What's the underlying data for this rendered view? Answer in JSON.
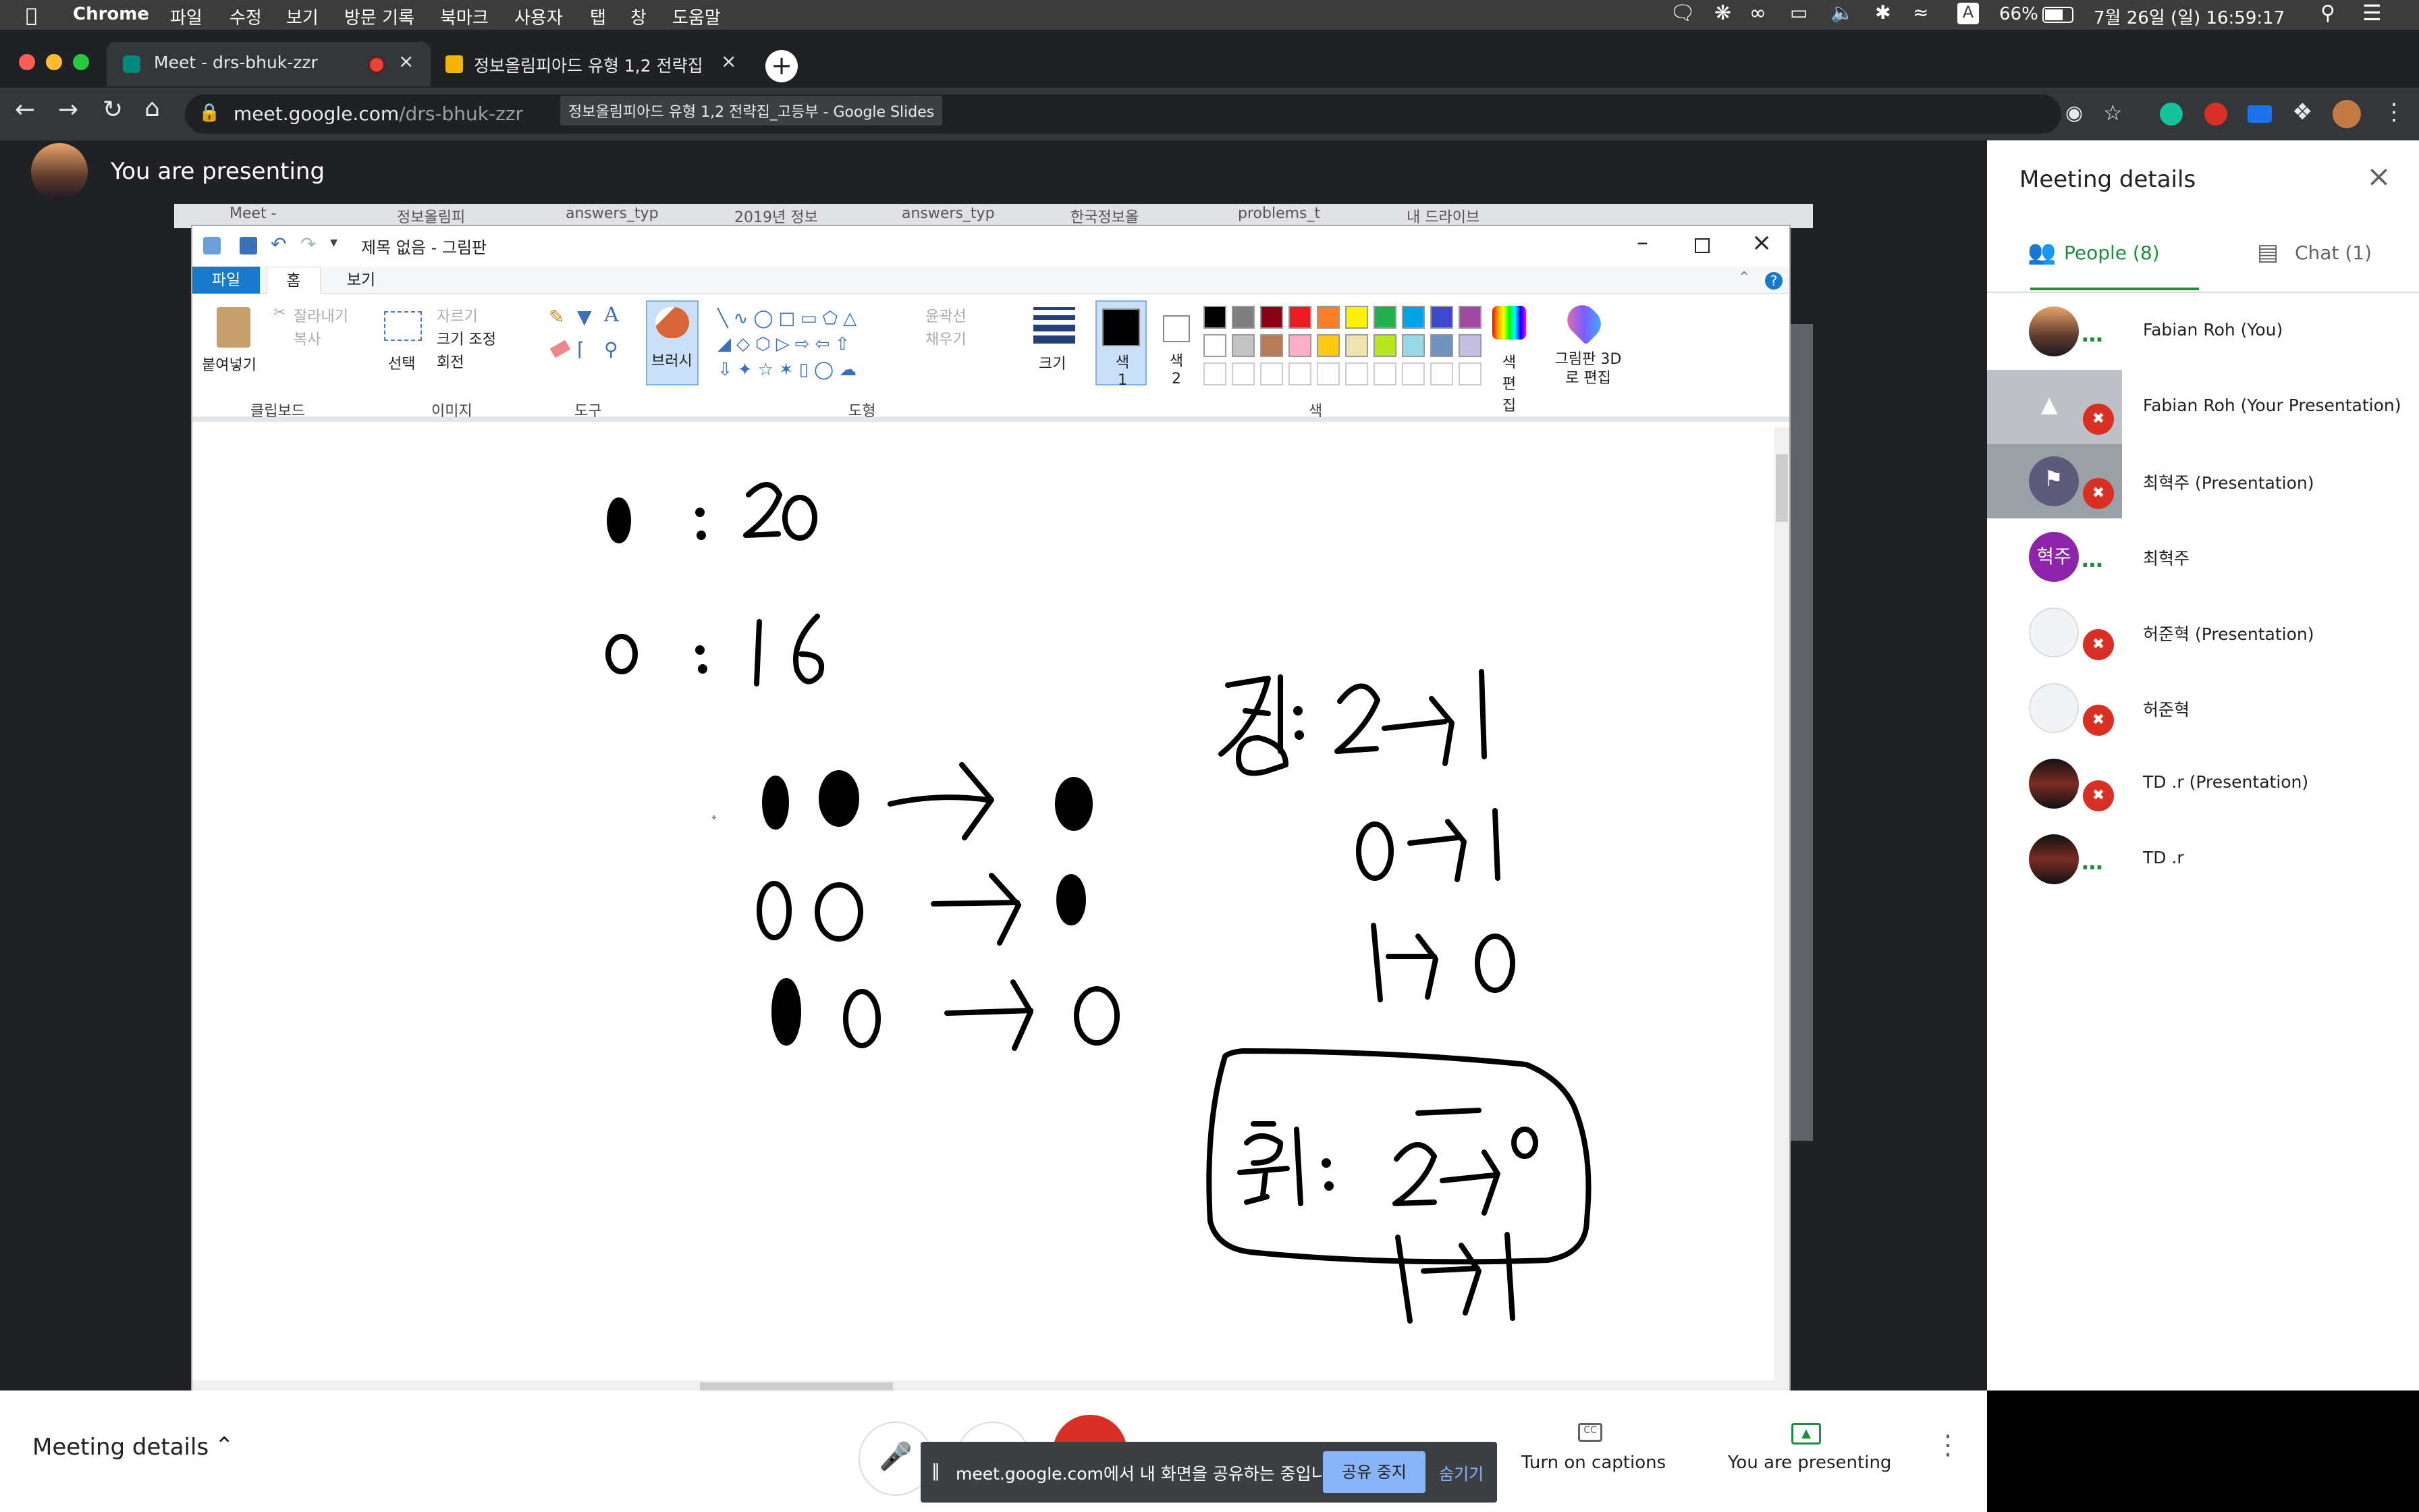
{
  "menubar": {
    "app": "Chrome",
    "items": [
      "파일",
      "수정",
      "보기",
      "방문 기록",
      "북마크",
      "사용자",
      "탭",
      "창",
      "도움말"
    ],
    "battery": "66%",
    "datetime": "7월 26일 (일) 16:59:17",
    "input_badge": "A"
  },
  "tabs": [
    {
      "title": "Meet - drs-bhuk-zzr",
      "active": true
    },
    {
      "title": "정보올림피아드 유형 1,2 전략집_고등",
      "active": false
    }
  ],
  "tooltip": "정보올림피아드 유형 1,2 전략집_고등부 - Google Slides",
  "omnibox": {
    "url_host": "meet.google.com",
    "url_path": "/drs-bhuk-zzr"
  },
  "presenting_banner": "You are presenting",
  "inner_tabs": [
    "Meet -",
    "정보올림피",
    "answers_typ",
    "2019년 정보",
    "answers_typ",
    "한국정보올",
    "problems_t",
    "내 드라이브"
  ],
  "paint": {
    "title": "제목 없음 - 그림판",
    "tabs": {
      "file": "파일",
      "home": "홈",
      "view": "보기"
    },
    "ribbon": {
      "paste": "붙여넣기",
      "cut": "잘라내기",
      "copy": "복사",
      "select": "선택",
      "crop": "자르기",
      "resize": "크기 조정",
      "rotate": "회전",
      "brush": "브러시",
      "outline": "윤곽선",
      "fill": "채우기",
      "size": "크기",
      "color1": "색 1",
      "color2": "색 2",
      "edit_colors": "색 편집",
      "paint3d": "그림판 3D로 편집",
      "group_clipboard": "클립보드",
      "group_image": "이미지",
      "group_tools": "도구",
      "group_shapes": "도형",
      "group_colors": "색"
    },
    "palette": [
      "#000000",
      "#7f7f7f",
      "#880015",
      "#ed1c24",
      "#ff7f27",
      "#fff200",
      "#22b14c",
      "#00a2e8",
      "#3f48cc",
      "#a349a4",
      "#ffffff",
      "#c3c3c3",
      "#b97a57",
      "#ffaec9",
      "#ffc90e",
      "#efe4b0",
      "#b5e61d",
      "#99d9ea",
      "#7092be",
      "#c8bfe7"
    ]
  },
  "panel": {
    "title": "Meeting details",
    "tab_people": "People (8)",
    "tab_chat": "Chat (1)",
    "people": [
      {
        "name": "Fabian Roh (You)",
        "muted": false,
        "avatar": "photo"
      },
      {
        "name": "Fabian Roh (Your Presentation)",
        "muted": true,
        "avatar": "present"
      },
      {
        "name": "최혁주 (Presentation)",
        "muted": true,
        "avatar": "pin"
      },
      {
        "name": "최혁주",
        "muted": false,
        "avatar": "letter",
        "initials": "혁주"
      },
      {
        "name": "허준혁 (Presentation)",
        "muted": true,
        "avatar": "drawn"
      },
      {
        "name": "허준혁",
        "muted": true,
        "avatar": "drawn"
      },
      {
        "name": "TD .r (Presentation)",
        "muted": true,
        "avatar": "dark"
      },
      {
        "name": "TD .r",
        "muted": false,
        "avatar": "dark"
      }
    ]
  },
  "bottom": {
    "meeting_details": "Meeting details",
    "captions": "Turn on captions",
    "presenting": "You are presenting"
  },
  "share_bar": {
    "text": "meet.google.com에서 내 화면을 공유하는 중입니다.",
    "stop": "공유 중지",
    "hide": "숨기기"
  },
  "colors": {
    "accent": "#1a73e8",
    "meet_green": "#1e8e3e",
    "mute_red": "#d93025",
    "stop_btn": "#8ab4f8"
  }
}
